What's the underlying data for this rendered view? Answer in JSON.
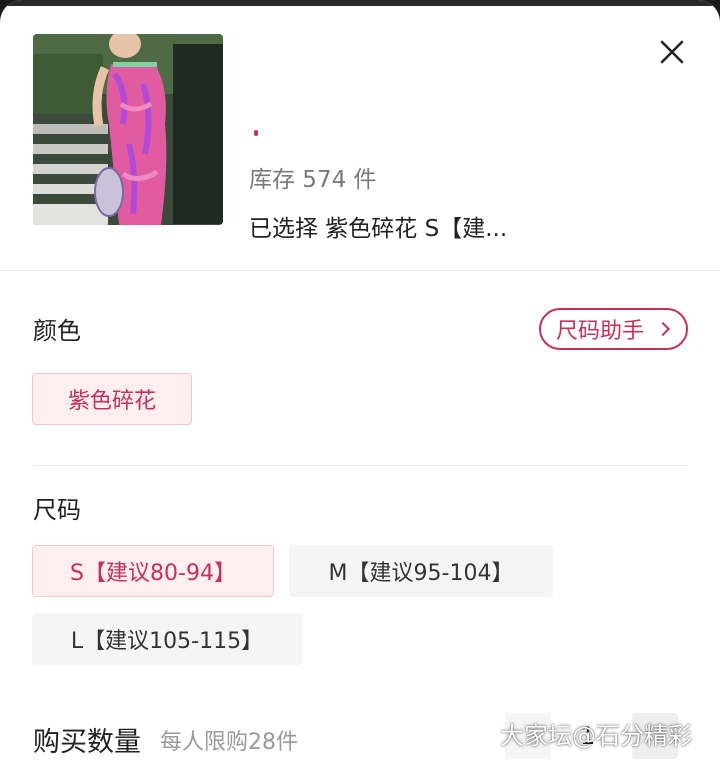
{
  "header": {
    "stock_text": "库存 574 件",
    "selected_text": "已选择  紫色碎花 S【建...",
    "accent_color": "#c8305a"
  },
  "color_section": {
    "label": "颜色",
    "size_helper": "尺码助手",
    "options": [
      "紫色碎花"
    ],
    "selected": "紫色碎花"
  },
  "size_section": {
    "label": "尺码",
    "options": [
      "S【建议80-94】",
      "M【建议95-104】",
      "L【建议105-115】"
    ],
    "selected": "S【建议80-94】"
  },
  "quantity": {
    "label": "购买数量",
    "limit": "每人限购28件",
    "value": "1"
  },
  "watermark": "大家坛@石分精彩",
  "icons": {
    "close": "close-icon",
    "chevron": "chevron-right-icon"
  }
}
